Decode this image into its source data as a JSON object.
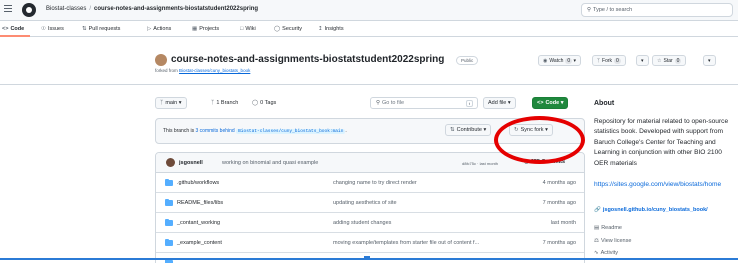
{
  "header": {
    "owner": "Biostat-classes",
    "separator": "/",
    "repo": "course-notes-and-assignments-biostatstudent2022spring",
    "search_placeholder": "Type / to search"
  },
  "tabs": [
    {
      "icon": "code-icon",
      "label": "Code"
    },
    {
      "icon": "issues-icon",
      "label": "Issues"
    },
    {
      "icon": "pull-request-icon",
      "label": "Pull requests"
    },
    {
      "icon": "actions-icon",
      "label": "Actions"
    },
    {
      "icon": "projects-icon",
      "label": "Projects"
    },
    {
      "icon": "wiki-icon",
      "label": "Wiki"
    },
    {
      "icon": "shield-icon",
      "label": "Security"
    },
    {
      "icon": "graph-icon",
      "label": "Insights"
    }
  ],
  "repo": {
    "title": "course-notes-and-assignments-biostatstudent2022spring",
    "visibility": "Public",
    "forked_prefix": "forked from",
    "forked_from": "Biostat-classes/cuny_biostats_book",
    "watch": {
      "label": "Watch",
      "count": "0"
    },
    "fork": {
      "label": "Fork",
      "count": "0"
    },
    "star": {
      "label": "Star",
      "count": "0"
    }
  },
  "toolbar": {
    "branch": "main",
    "branches": "1 Branch",
    "tags": "0 Tags",
    "go_to_file": "Go to file",
    "go_to_file_key": "t",
    "add_file": "Add file",
    "code": "Code"
  },
  "behind": {
    "text_pre": "This branch is",
    "commits": "3 commits behind",
    "ref": "Biostat-classes/cuny_biostats_book:main",
    "end": ".",
    "contribute": "Contribute",
    "sync_fork": "Sync fork"
  },
  "latest_commit": {
    "user": "jsgosnell",
    "message": "working on binomial and quasi example",
    "meta": "d8fc75c · last month",
    "commits": "255 Commits"
  },
  "files": [
    {
      "name": ".github/workflows",
      "message": "changing name to try direct render",
      "date": "4 months ago"
    },
    {
      "name": "README_files/libs",
      "message": "updating aesthetics of site",
      "date": "7 months ago"
    },
    {
      "name": "_contant_working",
      "message": "adding student changes",
      "date": "last month"
    },
    {
      "name": "_example_content",
      "message": "moving example/templates from starter file out of content f...",
      "date": "7 months ago"
    }
  ],
  "about": {
    "heading": "About",
    "description": "Repository for material related to open-source statistics book. Developed with support from Baruch College's Center for Teaching and Learning in conjunction with other BIO 2100 OER materials",
    "url": "https://sites.google.com/view/biostats/home",
    "site": "jsgosnell.github.io/cuny_biostats_book/",
    "readme": "Readme",
    "license": "View license",
    "activity": "Activity"
  },
  "annotation": {
    "color": "#e50000"
  }
}
